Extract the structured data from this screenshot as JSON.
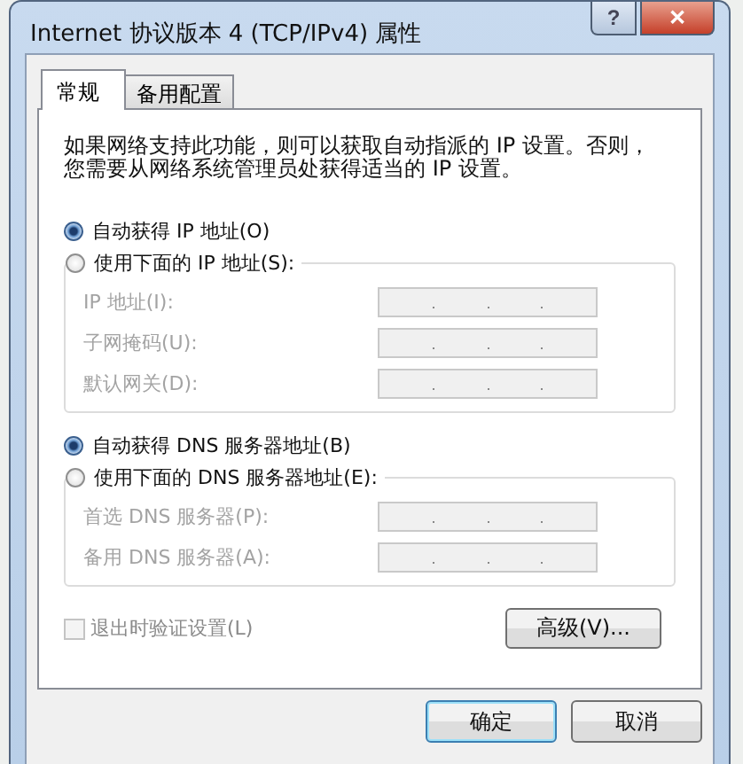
{
  "window": {
    "title": "Internet 协议版本 4 (TCP/IPv4) 属性",
    "help_button": "?",
    "close_button": "✕"
  },
  "tabs": [
    {
      "label": "常规",
      "selected": true
    },
    {
      "label": "备用配置",
      "selected": false
    }
  ],
  "description": "如果网络支持此功能，则可以获取自动指派的 IP 设置。否则，您需要从网络系统管理员处获得适当的 IP 设置。",
  "ip_options": [
    {
      "label": "自动获得 IP 地址(O)",
      "selected": true
    },
    {
      "label": "使用下面的 IP 地址(S):",
      "selected": false
    }
  ],
  "ip_fields": [
    {
      "label": "IP 地址(I):",
      "disabled": true
    },
    {
      "label": "子网掩码(U):",
      "disabled": true
    },
    {
      "label": "默认网关(D):",
      "disabled": true
    }
  ],
  "dns_options": [
    {
      "label": "自动获得 DNS 服务器地址(B)",
      "selected": true
    },
    {
      "label": "使用下面的 DNS 服务器地址(E):",
      "selected": false
    }
  ],
  "dns_fields": [
    {
      "label": "首选 DNS 服务器(P):",
      "disabled": true
    },
    {
      "label": "备用 DNS 服务器(A):",
      "disabled": true
    }
  ],
  "validate_checkbox": {
    "label": "退出时验证设置(L)",
    "checked": false,
    "disabled": true
  },
  "advanced_button": "高级(V)...",
  "buttons": [
    {
      "label": "确定",
      "default": true
    },
    {
      "label": "取消",
      "default": false
    }
  ]
}
